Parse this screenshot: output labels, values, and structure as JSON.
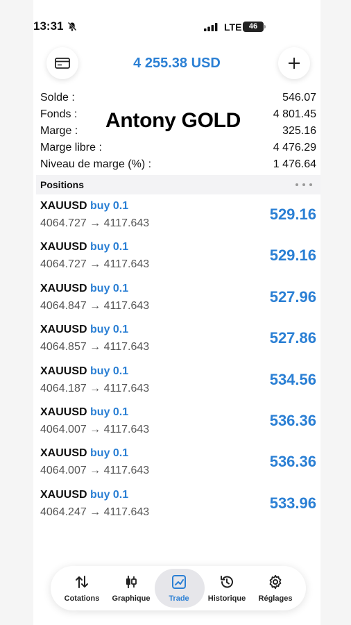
{
  "status_bar": {
    "time": "13:31",
    "carrier": "LTE",
    "battery": "46"
  },
  "header": {
    "equity": "4 255.38 USD"
  },
  "account": {
    "rows": [
      {
        "label": "Solde :",
        "value": "546.07"
      },
      {
        "label": "Fonds :",
        "value": "4 801.45"
      },
      {
        "label": "Marge :",
        "value": "325.16"
      },
      {
        "label": "Marge libre :",
        "value": "4 476.29"
      },
      {
        "label": "Niveau de marge (%) :",
        "value": "1 476.64"
      }
    ],
    "overlay_name": "Antony GOLD"
  },
  "positions": {
    "title": "Positions",
    "items": [
      {
        "symbol": "XAUUSD",
        "side": "buy 0.1",
        "prices": "4064.727 → 4117.643",
        "profit": "529.16"
      },
      {
        "symbol": "XAUUSD",
        "side": "buy 0.1",
        "prices": "4064.727 → 4117.643",
        "profit": "529.16"
      },
      {
        "symbol": "XAUUSD",
        "side": "buy 0.1",
        "prices": "4064.847 → 4117.643",
        "profit": "527.96"
      },
      {
        "symbol": "XAUUSD",
        "side": "buy 0.1",
        "prices": "4064.857 → 4117.643",
        "profit": "527.86"
      },
      {
        "symbol": "XAUUSD",
        "side": "buy 0.1",
        "prices": "4064.187 → 4117.643",
        "profit": "534.56"
      },
      {
        "symbol": "XAUUSD",
        "side": "buy 0.1",
        "prices": "4064.007 → 4117.643",
        "profit": "536.36"
      },
      {
        "symbol": "XAUUSD",
        "side": "buy 0.1",
        "prices": "4064.007 → 4117.643",
        "profit": "536.36"
      },
      {
        "symbol": "XAUUSD",
        "side": "buy 0.1",
        "prices": "4064.247 → 4117.643",
        "profit": "533.96"
      }
    ]
  },
  "tabbar": {
    "tabs": [
      {
        "label": "Cotations",
        "icon": "arrows-updown-icon"
      },
      {
        "label": "Graphique",
        "icon": "candlestick-icon"
      },
      {
        "label": "Trade",
        "icon": "trend-chart-icon",
        "active": true
      },
      {
        "label": "Historique",
        "icon": "history-icon"
      },
      {
        "label": "Réglages",
        "icon": "gear-icon"
      }
    ]
  },
  "colors": {
    "accent": "#2a7fd4",
    "text": "#111111",
    "muted": "#555555"
  }
}
